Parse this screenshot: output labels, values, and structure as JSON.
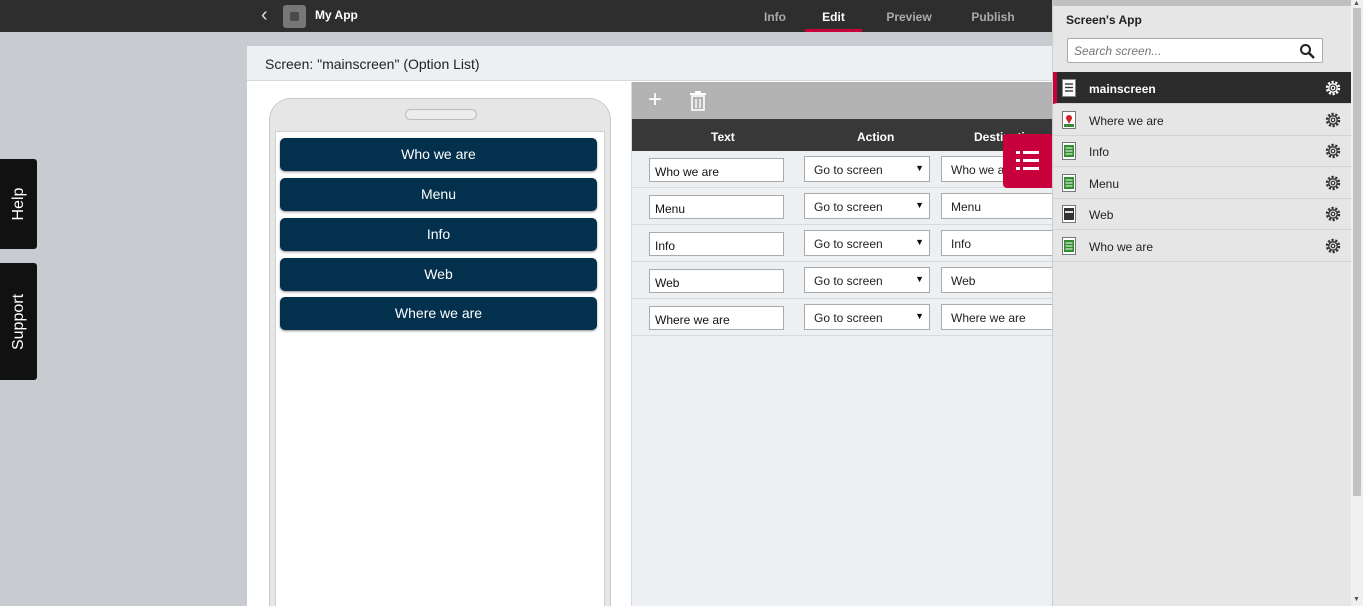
{
  "header": {
    "app_title": "My App",
    "tabs": [
      {
        "label": "Info",
        "active": false
      },
      {
        "label": "Edit",
        "active": true
      },
      {
        "label": "Preview",
        "active": false
      },
      {
        "label": "Publish",
        "active": false
      }
    ]
  },
  "side_tabs": {
    "help": "Help",
    "support": "Support"
  },
  "panel": {
    "title": "Screen: \"mainscreen\" (Option List)"
  },
  "preview": {
    "options": [
      "Who we are",
      "Menu",
      "Info",
      "Web",
      "Where we are"
    ]
  },
  "editor": {
    "columns": [
      "Text",
      "Action",
      "Destination"
    ],
    "rows": [
      {
        "text": "Who we are",
        "action": "Go to screen",
        "destination": "Who we are"
      },
      {
        "text": "Menu",
        "action": "Go to screen",
        "destination": "Menu"
      },
      {
        "text": "Info",
        "action": "Go to screen",
        "destination": "Info"
      },
      {
        "text": "Web",
        "action": "Go to screen",
        "destination": "Web"
      },
      {
        "text": "Where we are",
        "action": "Go to screen",
        "destination": "Where we are"
      }
    ]
  },
  "sidebar": {
    "title": "Screen's App",
    "search_placeholder": "Search screen...",
    "screens": [
      {
        "label": "mainscreen",
        "icon": "list-doc-icon",
        "active": true
      },
      {
        "label": "Where we are",
        "icon": "map-doc-icon",
        "active": false
      },
      {
        "label": "Info",
        "icon": "text-doc-icon",
        "active": false
      },
      {
        "label": "Menu",
        "icon": "text-doc-icon",
        "active": false
      },
      {
        "label": "Web",
        "icon": "web-doc-icon",
        "active": false
      },
      {
        "label": "Who we are",
        "icon": "text-doc-icon",
        "active": false
      }
    ]
  },
  "colors": {
    "accent": "#c8003b",
    "option_button": "#02304d",
    "topbar": "#2e2e2e"
  }
}
